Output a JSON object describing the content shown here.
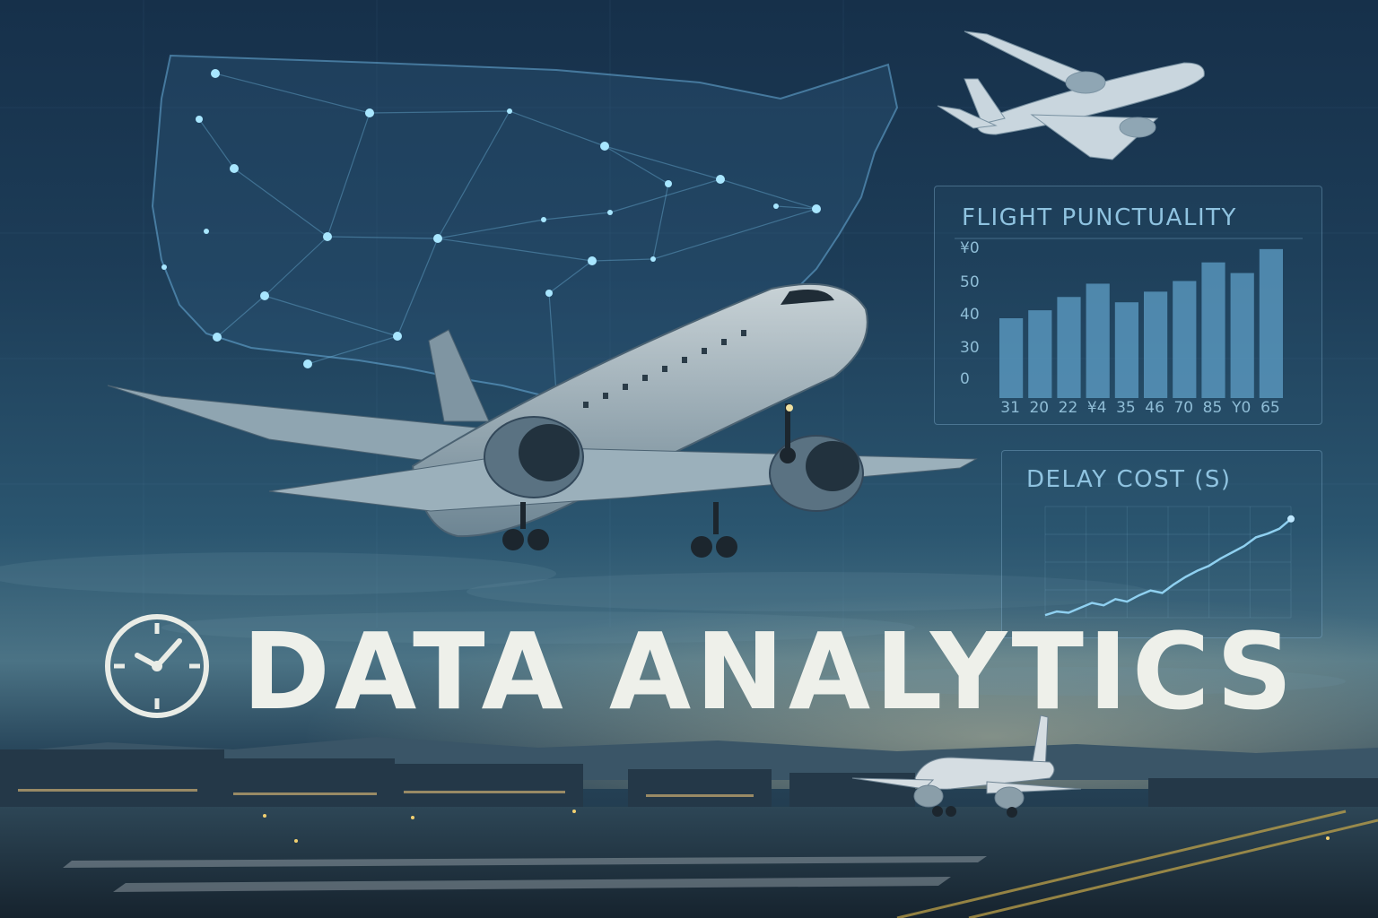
{
  "headline": "DATA ANALYTICS",
  "icons": {
    "headline_icon": "clock-icon"
  },
  "colors": {
    "headline_text": "#eef0ea",
    "panel_accent": "#8fc3e0",
    "bar_fill": "#5f9fc7",
    "network_node": "#9fe2ff"
  },
  "chart_data": [
    {
      "type": "bar",
      "title": "FLIGHT PUNCTUALITY",
      "y_tick_labels": [
        "0",
        "30",
        "40",
        "50",
        "¥0"
      ],
      "x_tick_labels": [
        "31",
        "20",
        "22",
        "¥4",
        "35",
        "46",
        "70",
        "85",
        "Y0",
        "65"
      ],
      "values": [
        30,
        33,
        38,
        43,
        36,
        40,
        44,
        51,
        47,
        56
      ],
      "ylim": [
        0,
        60
      ]
    },
    {
      "type": "line",
      "title": "DELAY COST (S)",
      "values": [
        2,
        5,
        4,
        8,
        12,
        10,
        15,
        13,
        18,
        22,
        20,
        27,
        33,
        38,
        42,
        48,
        53,
        58,
        65,
        68,
        72,
        80
      ],
      "ylim": [
        0,
        90
      ]
    }
  ]
}
